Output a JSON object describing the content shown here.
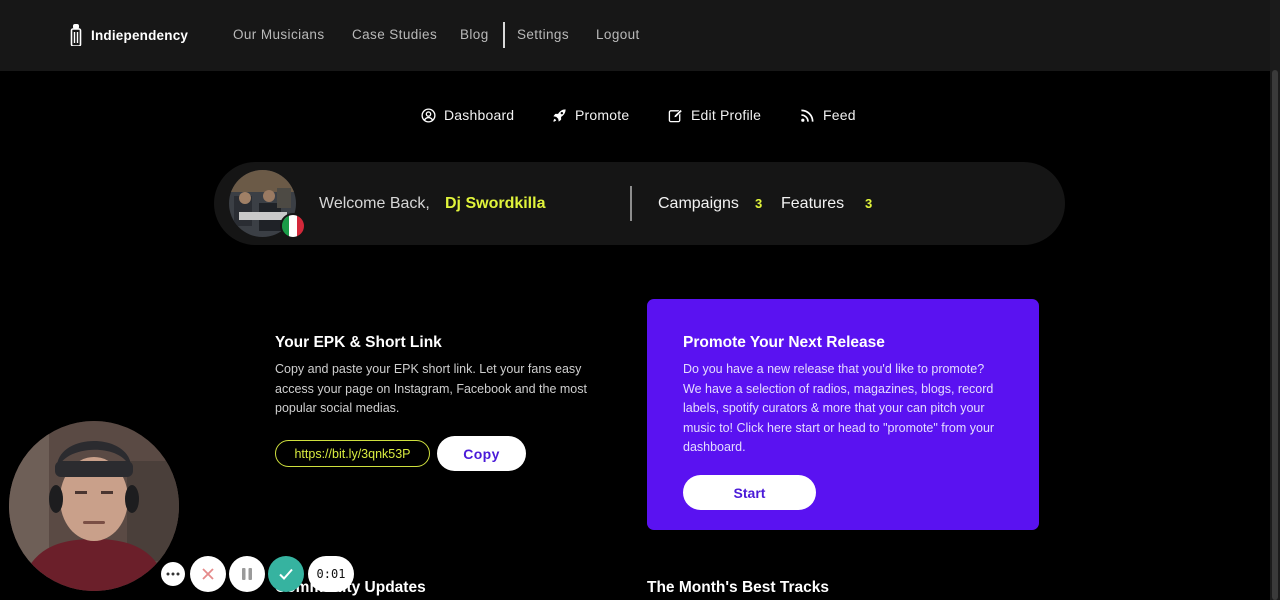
{
  "brand": {
    "name": "Indiependency"
  },
  "topnav": {
    "items": [
      "Our Musicians",
      "Case Studies",
      "Blog",
      "Settings",
      "Logout"
    ]
  },
  "subnav": {
    "items": [
      {
        "label": "Dashboard",
        "icon": "user-circle-icon"
      },
      {
        "label": "Promote",
        "icon": "rocket-icon"
      },
      {
        "label": "Edit Profile",
        "icon": "edit-icon"
      },
      {
        "label": "Feed",
        "icon": "rss-icon"
      }
    ]
  },
  "welcome": {
    "greeting": "Welcome Back,",
    "name": "Dj Swordkilla",
    "flag": "italy-flag-icon",
    "stats": [
      {
        "label": "Campaigns",
        "value": "3"
      },
      {
        "label": "Features",
        "value": "3"
      }
    ]
  },
  "epk": {
    "title": "Your EPK & Short Link",
    "description": "Copy and paste your EPK short link. Let your fans easy access your page on Instagram, Facebook and the most popular social medias.",
    "short_link": "https://bit.ly/3qnk53P",
    "copy_label": "Copy"
  },
  "promote": {
    "title": "Promote Your Next Release",
    "description": "Do you have a new release that you'd like to promote? We have a selection of radios, magazines, blogs, record labels, spotify curators & more that your can pitch your music to!  Click here start or head to \"promote\" from your dashboard.",
    "start_label": "Start"
  },
  "sections": {
    "community": "Community Updates",
    "best_tracks": "The Month's Best Tracks"
  },
  "recorder": {
    "timer": "0:01",
    "buttons": [
      "more-icon",
      "close-icon",
      "pause-icon",
      "check-icon"
    ]
  },
  "colors": {
    "accent_yellow": "#e1f43b",
    "promo_purple": "#5a12f1",
    "button_text": "#4a1ad8",
    "topbar": "#171717",
    "card": "#151515"
  }
}
